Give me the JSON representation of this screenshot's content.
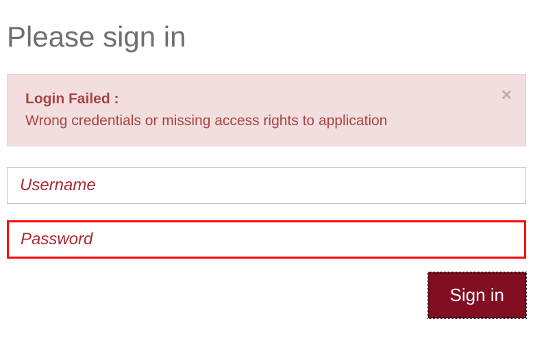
{
  "title": "Please sign in",
  "alert": {
    "title": "Login Failed :",
    "message": "Wrong credentials or missing access rights to application",
    "close_glyph": "×"
  },
  "form": {
    "username": {
      "placeholder": "Username",
      "value": ""
    },
    "password": {
      "placeholder": "Password",
      "value": ""
    },
    "submit_label": "Sign in"
  }
}
